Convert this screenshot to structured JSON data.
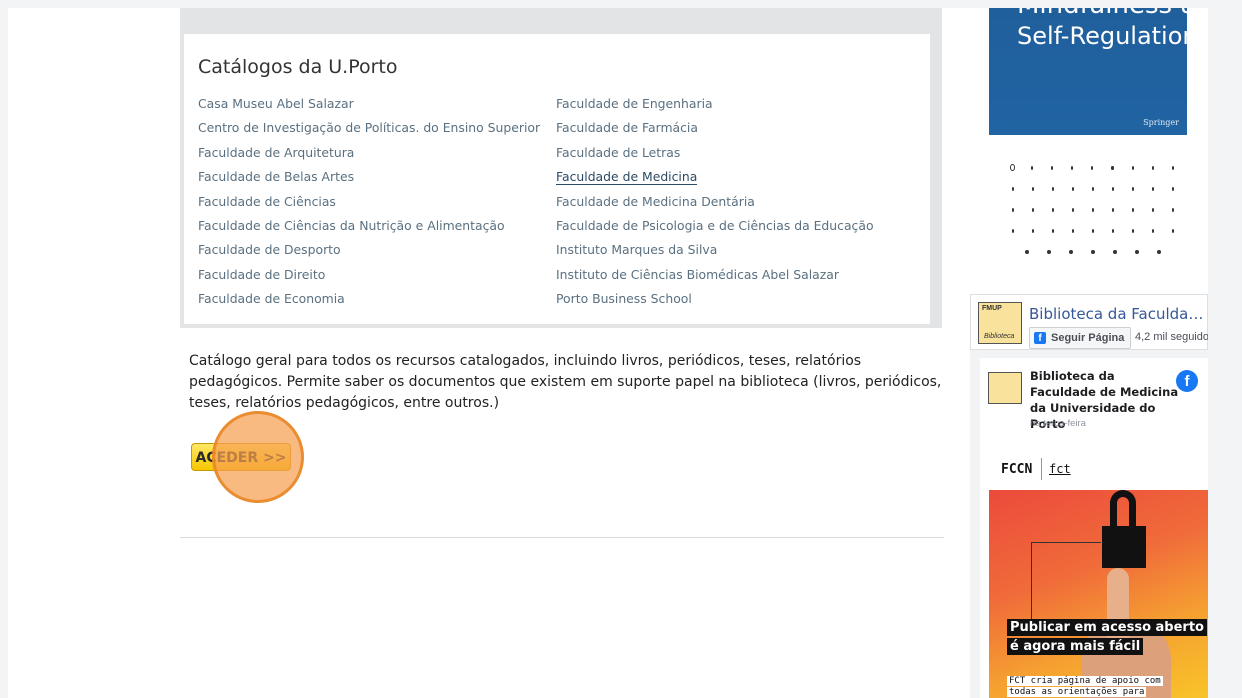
{
  "catalogs": {
    "title": "Catálogos da U.Porto",
    "left_column": [
      "Casa Museu Abel Salazar",
      "Centro de Investigação de Políticas. do Ensino Superior",
      "Faculdade de Arquitetura",
      "Faculdade de Belas Artes",
      "Faculdade de Ciências",
      "Faculdade de Ciências da Nutrição e Alimentação",
      "Faculdade de Desporto",
      "Faculdade de Direito",
      "Faculdade de Economia"
    ],
    "right_column": [
      "Faculdade de Engenharia",
      "Faculdade de Farmácia",
      "Faculdade de Letras",
      "Faculdade de Medicina",
      "Faculdade de Medicina Dentária",
      "Faculdade de Psicologia e de Ciências da Educação",
      "Instituto Marques da Silva",
      "Instituto de Ciências Biomédicas Abel Salazar",
      "Porto Business School"
    ],
    "active_item": "Faculdade de Medicina"
  },
  "description": "Catálogo geral para todos os recursos catalogados, incluindo livros, periódicos, teses, relatórios pedagógicos. Permite saber os documentos que existem em suporte papel na biblioteca (livros, periódicos, teses, relatórios pedagógicos, entre outros.)",
  "aceder_button": "ACEDER >>",
  "book": {
    "title_top": "Mindfulness and",
    "title": "Self-Regulation",
    "publisher": "Springer"
  },
  "carousel": {
    "rows": [
      9,
      9,
      9,
      9,
      7
    ],
    "active_index": 0
  },
  "facebook": {
    "page_name": "Biblioteca da Faculda…",
    "follow_label": "Seguir Página",
    "followers": "4,2 mil seguido",
    "logo_text": "FMUP",
    "logo_subtext": "Biblioteca",
    "post": {
      "author": "Biblioteca da Faculdade de Medicina da Universidade do Porto",
      "date": "na terça-feira",
      "image_brand": "FCCN",
      "image_brand2": "fct",
      "caption_line1": "Publicar em acesso aberto",
      "caption_line2": "é agora mais fácil",
      "footer_line1": "FCT cria página de apoio com",
      "footer_line2": "todas as orientações para"
    }
  },
  "colors": {
    "link": "#5a7080",
    "button_yellow": "#f7c600",
    "click_marker": "#f7a050",
    "facebook_blue": "#1877f2"
  }
}
